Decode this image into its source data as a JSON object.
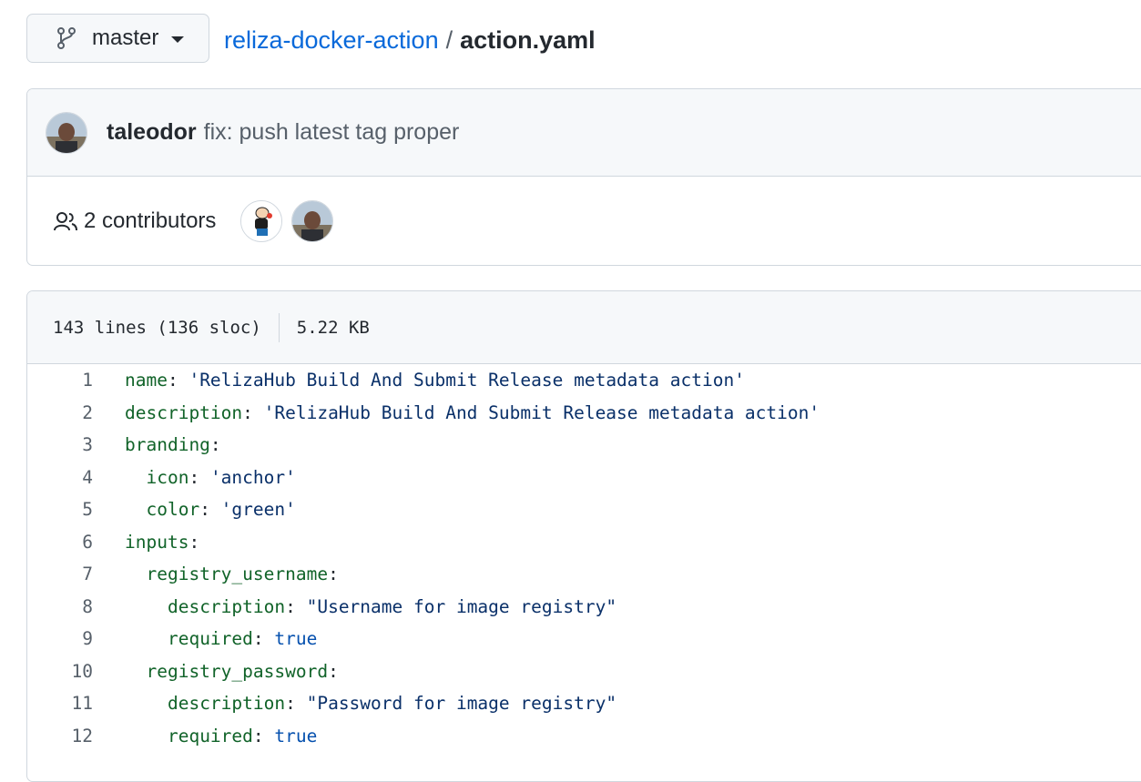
{
  "branch": {
    "label": "master"
  },
  "breadcrumb": {
    "repo": "reliza-docker-action",
    "separator": "/",
    "file": "action.yaml"
  },
  "commit": {
    "author": "taleodor",
    "message": "fix: push latest tag proper"
  },
  "contributors": {
    "label": "2 contributors"
  },
  "file_info": {
    "lines": "143 lines (136 sloc)",
    "size": "5.22 KB"
  },
  "code_lines": [
    {
      "num": "1",
      "indent": "",
      "key": "name",
      "colon": ": ",
      "value": "'RelizaHub Build And Submit Release metadata action'",
      "vtype": "s"
    },
    {
      "num": "2",
      "indent": "",
      "key": "description",
      "colon": ": ",
      "value": "'RelizaHub Build And Submit Release metadata action'",
      "vtype": "s"
    },
    {
      "num": "3",
      "indent": "",
      "key": "branding",
      "colon": ":",
      "value": "",
      "vtype": "s"
    },
    {
      "num": "4",
      "indent": "  ",
      "key": "icon",
      "colon": ": ",
      "value": "'anchor'",
      "vtype": "s"
    },
    {
      "num": "5",
      "indent": "  ",
      "key": "color",
      "colon": ": ",
      "value": "'green'",
      "vtype": "s"
    },
    {
      "num": "6",
      "indent": "",
      "key": "inputs",
      "colon": ":",
      "value": "",
      "vtype": "s"
    },
    {
      "num": "7",
      "indent": "  ",
      "key": "registry_username",
      "colon": ":",
      "value": "",
      "vtype": "s"
    },
    {
      "num": "8",
      "indent": "    ",
      "key": "description",
      "colon": ": ",
      "value": "\"Username for image registry\"",
      "vtype": "s"
    },
    {
      "num": "9",
      "indent": "    ",
      "key": "required",
      "colon": ": ",
      "value": "true",
      "vtype": "b"
    },
    {
      "num": "10",
      "indent": "  ",
      "key": "registry_password",
      "colon": ":",
      "value": "",
      "vtype": "s"
    },
    {
      "num": "11",
      "indent": "    ",
      "key": "description",
      "colon": ": ",
      "value": "\"Password for image registry\"",
      "vtype": "s"
    },
    {
      "num": "12",
      "indent": "    ",
      "key": "required",
      "colon": ": ",
      "value": "true",
      "vtype": "b"
    }
  ]
}
